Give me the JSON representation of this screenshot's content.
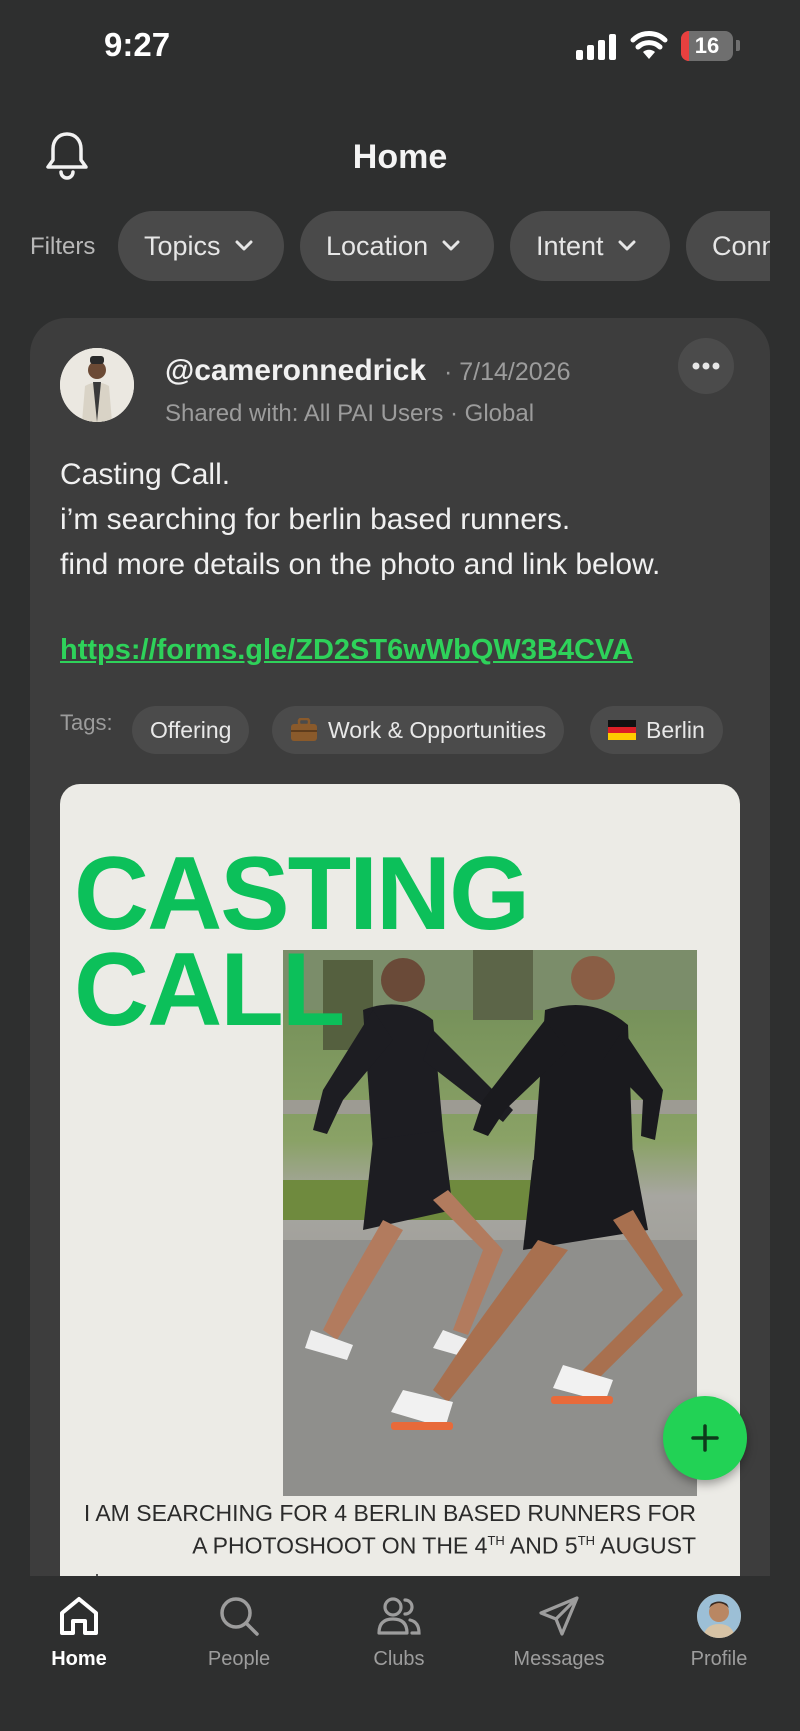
{
  "status_bar": {
    "time": "9:27",
    "battery": "16",
    "battery_level": 0.16
  },
  "header": {
    "title": "Home"
  },
  "filters": {
    "label": "Filters",
    "chips": [
      "Topics",
      "Location",
      "Intent",
      "Conn"
    ]
  },
  "post": {
    "handle": "@cameronnedrick",
    "date": "· 7/14/2026",
    "shared": "Shared with: All PAI Users · Global",
    "body_lines": [
      "Casting Call.",
      "i’m searching for berlin based runners.",
      "find more details on the photo and link below."
    ],
    "link": "https://forms.gle/ZD2ST6wWbQW3B4CVA",
    "tags_label": "Tags:",
    "tags": [
      "Offering",
      "Work & Opportunities",
      "Berlin"
    ],
    "poster": {
      "title_line1": "CASTING",
      "title_line2": "CALL",
      "caption_line1": "I AM SEARCHING FOR 4 BERLIN BASED RUNNERS FOR",
      "caption_line2_a": "A PHOTOSHOOT ON THE 4",
      "caption_sup1": "TH",
      "caption_line2_b": " AND 5",
      "caption_sup2": "TH",
      "caption_line2_c": " AUGUST"
    }
  },
  "tabbar": {
    "items": [
      {
        "label": "Home",
        "icon": "home-icon"
      },
      {
        "label": "People",
        "icon": "search-icon"
      },
      {
        "label": "Clubs",
        "icon": "people-icon"
      },
      {
        "label": "Messages",
        "icon": "send-icon"
      },
      {
        "label": "Profile",
        "icon": "avatar"
      }
    ]
  },
  "colors": {
    "background": "#2e2f2f",
    "card": "#3d3d3d",
    "accent": "#22d255",
    "poster_green": "#0cc05a"
  }
}
